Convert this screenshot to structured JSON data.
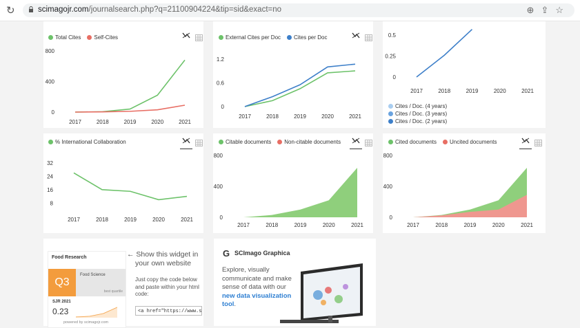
{
  "browser": {
    "url_domain": "scimagojr.com",
    "url_rest": "/journalsearch.php?q=21100904224&tip=sid&exact=no"
  },
  "icons": {
    "reload": "↻",
    "zoom": "⊕",
    "share": "⇪",
    "star": "☆",
    "widget_arrow": "←"
  },
  "colors": {
    "green": "#6dc26a",
    "red": "#e86e64",
    "blue": "#3d7fc9",
    "light_blue": "#a9cdf0",
    "mid_blue": "#6aa3df",
    "green_fill": "#8fcf7c",
    "red_fill": "#ef978f",
    "quartile": "#f39c3d"
  },
  "charts": {
    "total_cites": {
      "legend": [
        "Total Cites",
        "Self-Cites"
      ],
      "yticks": [
        "800",
        "400",
        "0"
      ],
      "xticks": [
        "2017",
        "2018",
        "2019",
        "2020",
        "2021"
      ]
    },
    "cites_per_doc": {
      "legend": [
        "External Cites per Doc",
        "Cites per Doc"
      ],
      "yticks": [
        "1.2",
        "0.6",
        "0"
      ],
      "xticks": [
        "2017",
        "2018",
        "2019",
        "2020",
        "2021"
      ]
    },
    "cites_doc_years": {
      "yticks": [
        "0.5",
        "0.25",
        "0"
      ],
      "xticks": [
        "2017",
        "2018",
        "2019",
        "2020",
        "2021"
      ],
      "legend": [
        "Cites / Doc. (4 years)",
        "Cites / Doc. (3 years)",
        "Cites / Doc. (2 years)"
      ]
    },
    "intl_collab": {
      "legend": [
        "% International Collaboration"
      ],
      "yticks": [
        "32",
        "24",
        "16",
        "8"
      ],
      "xticks": [
        "2017",
        "2018",
        "2019",
        "2020",
        "2021"
      ]
    },
    "citable_docs": {
      "legend": [
        "Citable documents",
        "Non-citable documents"
      ],
      "yticks": [
        "800",
        "400",
        "0"
      ],
      "xticks": [
        "2017",
        "2018",
        "2019",
        "2020",
        "2021"
      ]
    },
    "cited_docs": {
      "legend": [
        "Cited documents",
        "Uncited documents"
      ],
      "yticks": [
        "800",
        "400",
        "0"
      ],
      "xticks": [
        "2017",
        "2018",
        "2019",
        "2020",
        "2021"
      ]
    }
  },
  "chart_data": [
    {
      "type": "line",
      "x": [
        2017,
        2018,
        2019,
        2020,
        2021
      ],
      "series": [
        {
          "name": "Total Cites",
          "values": [
            0,
            5,
            40,
            220,
            680
          ]
        },
        {
          "name": "Self-Cites",
          "values": [
            0,
            3,
            10,
            30,
            90
          ]
        }
      ],
      "ylim": [
        0,
        800
      ]
    },
    {
      "type": "line",
      "x": [
        2017,
        2018,
        2019,
        2020,
        2021
      ],
      "series": [
        {
          "name": "External Cites per Doc",
          "values": [
            0,
            0.15,
            0.45,
            0.85,
            0.9
          ]
        },
        {
          "name": "Cites per Doc",
          "values": [
            0,
            0.25,
            0.55,
            1.0,
            1.07
          ]
        }
      ],
      "ylim": [
        0,
        1.3
      ]
    },
    {
      "type": "line",
      "x": [
        2017,
        2018,
        2019
      ],
      "series": [
        {
          "name": "Cites / Doc. (2 years)",
          "values": [
            0,
            0.26,
            0.57
          ]
        }
      ],
      "ylim": [
        0,
        0.6
      ]
    },
    {
      "type": "line",
      "x": [
        2017,
        2018,
        2019,
        2020,
        2021
      ],
      "series": [
        {
          "name": "% International Collaboration",
          "values": [
            26,
            16,
            15,
            10,
            12
          ]
        }
      ],
      "ylim": [
        4,
        34
      ]
    },
    {
      "type": "area",
      "x": [
        2017,
        2018,
        2019,
        2020,
        2021
      ],
      "series": [
        {
          "name": "Citable documents",
          "values": [
            0,
            30,
            100,
            220,
            640
          ]
        },
        {
          "name": "Non-citable documents",
          "values": [
            0,
            0,
            0,
            0,
            0
          ]
        }
      ],
      "ylim": [
        0,
        800
      ]
    },
    {
      "type": "area",
      "x": [
        2017,
        2018,
        2019,
        2020,
        2021
      ],
      "series": [
        {
          "name": "Cited documents",
          "values": [
            0,
            30,
            100,
            220,
            640
          ]
        },
        {
          "name": "Uncited documents",
          "values": [
            0,
            25,
            70,
            100,
            290
          ]
        }
      ],
      "ylim": [
        0,
        800
      ]
    }
  ],
  "widget": {
    "journal": "Food Research",
    "quartile": "Q3",
    "category": "Food Science",
    "best_quartile": "best quartile",
    "sjr_label": "SJR 2021",
    "sjr_value": "0.23",
    "powered_by": "powered by scimagojr.com",
    "show_line1": "Show this widget in",
    "show_line2": "your own website",
    "copy_line1": "Just copy the code below",
    "copy_line2": "and paste within your html",
    "copy_line3": "code:",
    "code_value": "<a href=\"https://www.scimag"
  },
  "graphica": {
    "title": "SCImago Graphica",
    "line1": "Explore, visually",
    "line2": "communicate and make",
    "line3": "sense of data with our",
    "link1": "new data visualization",
    "link2": "tool",
    "period": "."
  }
}
